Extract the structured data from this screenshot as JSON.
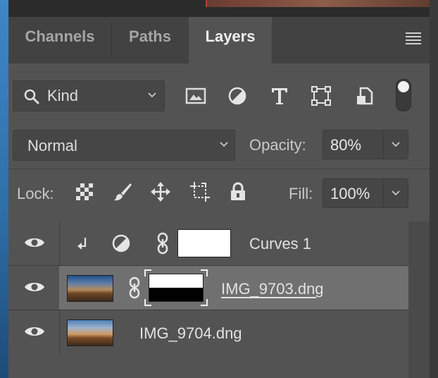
{
  "tabs": [
    {
      "label": "Channels",
      "active": false
    },
    {
      "label": "Paths",
      "active": false
    },
    {
      "label": "Layers",
      "active": true
    }
  ],
  "filter": {
    "kind_label": "Kind",
    "icons": [
      "image-filter-icon",
      "adjustment-filter-icon",
      "type-filter-icon",
      "shape-filter-icon",
      "smart-object-filter-icon"
    ],
    "toggle_on": true
  },
  "blend": {
    "mode": "Normal",
    "opacity_label": "Opacity:",
    "opacity_value": "80%"
  },
  "lock": {
    "label": "Lock:",
    "icons": [
      "lock-transparent-pixels-icon",
      "lock-image-pixels-icon",
      "lock-position-icon",
      "lock-artboard-icon",
      "lock-all-icon"
    ],
    "fill_label": "Fill:",
    "fill_value": "100%"
  },
  "layers": [
    {
      "name": "Curves 1",
      "type": "adjustment-curves",
      "visible": true,
      "clipped": true,
      "selected": false
    },
    {
      "name": "IMG_9703.dng",
      "type": "image-with-mask",
      "visible": true,
      "selected": true
    },
    {
      "name": "IMG_9704.dng",
      "type": "image",
      "visible": true,
      "selected": false
    }
  ],
  "colors": {
    "panel_bg": "#535353",
    "tab_bar_bg": "#424242",
    "selected_row": "#707070",
    "text": "#d8d8d8"
  }
}
